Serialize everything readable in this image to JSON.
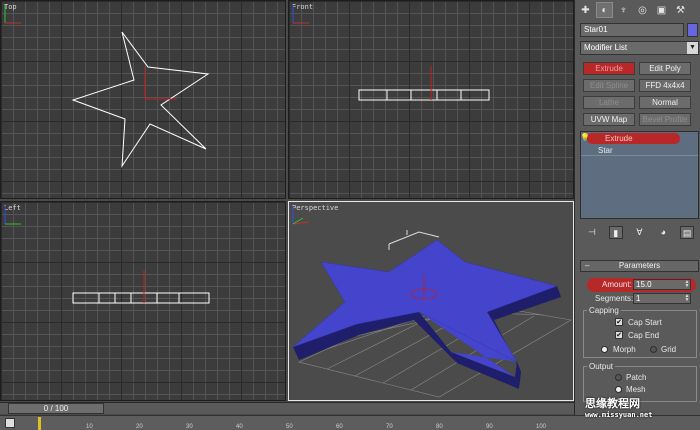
{
  "viewports": {
    "top": "Top",
    "front": "Front",
    "left": "Left",
    "perspective": "Perspective"
  },
  "panel": {
    "tab_icons": [
      "create-icon",
      "modify-icon",
      "hierarchy-icon",
      "motion-icon",
      "display-icon",
      "utilities-icon"
    ],
    "object_name": "Star01",
    "object_color": "#6666dd",
    "modifier_list": "Modifier List",
    "buttons": {
      "extrude": "Extrude",
      "edit_poly": "Edit Poly",
      "edit_spline": "Edit Spline",
      "ffd": "FFD 4x4x4",
      "lathe": "Lathe",
      "normal": "Normal",
      "uvw_map": "UVW Map",
      "bevel_profile": "Bevel Profile"
    },
    "stack": {
      "extrude": "Extrude",
      "star": "Star"
    },
    "parameters": {
      "title": "Parameters",
      "amount_label": "Amount:",
      "amount_value": "15.0",
      "segments_label": "Segments:",
      "segments_value": "1",
      "capping_label": "Capping",
      "cap_start": "Cap Start",
      "cap_end": "Cap End",
      "morph": "Morph",
      "grid": "Grid",
      "output_label": "Output",
      "patch": "Patch",
      "mesh": "Mesh",
      "cap_start_checked": true,
      "cap_end_checked": true,
      "capping_mode": "Morph",
      "output_mode": "Mesh"
    }
  },
  "timeline": {
    "slider": "0 / 100",
    "ticks": [
      "10",
      "20",
      "30",
      "40",
      "50",
      "60",
      "70",
      "80",
      "90",
      "100"
    ]
  },
  "watermark": {
    "chinese": "思缘教程网",
    "url": "www.missyuan.net"
  },
  "colors": {
    "star_fill": "#4444cc",
    "highlight": "#b82828",
    "stack_bg": "#5e6e80"
  }
}
